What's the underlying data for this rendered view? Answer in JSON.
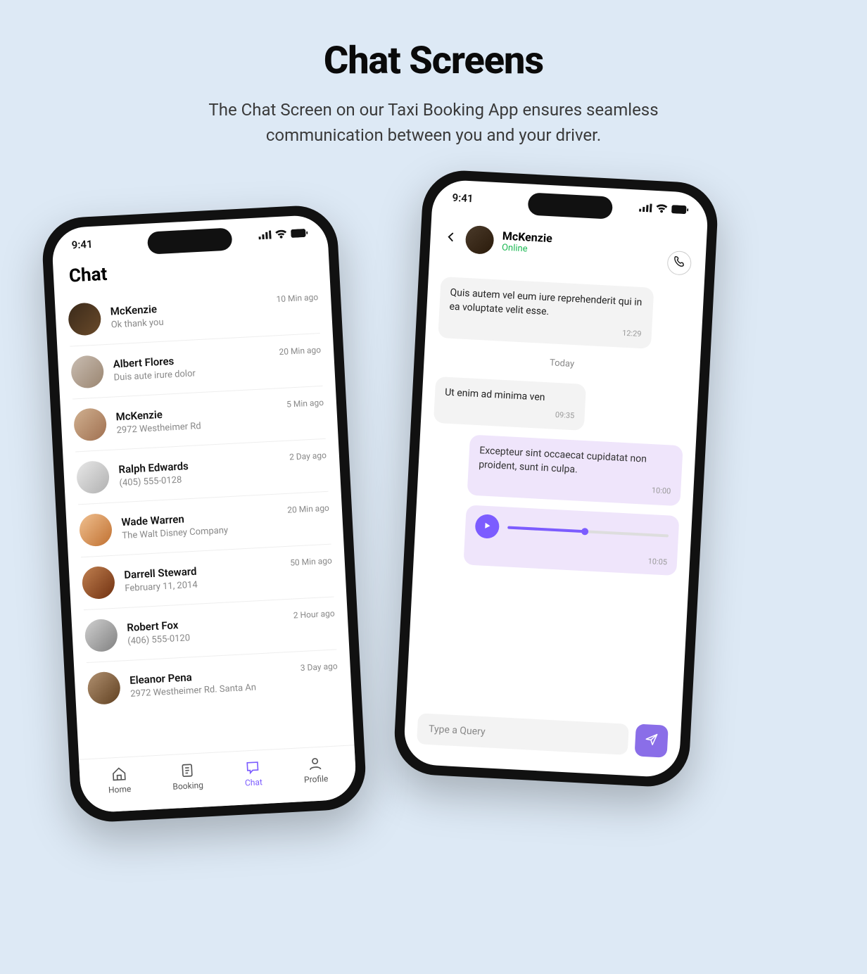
{
  "page": {
    "title": "Chat Screens",
    "subtitle": "The Chat Screen on our Taxi Booking App ensures seamless communication between you and your driver."
  },
  "status_time": "9:41",
  "left": {
    "title": "Chat",
    "chats": [
      {
        "name": "McKenzie",
        "sub": "Ok thank you",
        "time": "10 Min ago"
      },
      {
        "name": "Albert Flores",
        "sub": "Duis aute irure dolor",
        "time": "20 Min ago"
      },
      {
        "name": "McKenzie",
        "sub": "2972 Westheimer Rd",
        "time": "5 Min ago"
      },
      {
        "name": "Ralph Edwards",
        "sub": "(405) 555-0128",
        "time": "2 Day ago"
      },
      {
        "name": "Wade Warren",
        "sub": "The Walt Disney Company",
        "time": "20 Min ago"
      },
      {
        "name": "Darrell Steward",
        "sub": "February 11, 2014",
        "time": "50 Min ago"
      },
      {
        "name": "Robert Fox",
        "sub": "(406) 555-0120",
        "time": "2 Hour ago"
      },
      {
        "name": "Eleanor Pena",
        "sub": "2972 Westheimer Rd. Santa An",
        "time": "3 Day ago"
      }
    ],
    "nav": {
      "home": "Home",
      "booking": "Booking",
      "chat": "Chat",
      "profile": "Profile"
    }
  },
  "right": {
    "name": "McKenzie",
    "status": "Online",
    "messages": {
      "m1": {
        "text": "Quis autem vel eum iure reprehenderit qui in ea voluptate velit esse.",
        "time": "12:29"
      },
      "sep": "Today",
      "m2": {
        "text": "Ut enim ad minima ven",
        "time": "09:35"
      },
      "m3": {
        "text": "Excepteur sint occaecat cupidatat non proident, sunt in culpa.",
        "time": "10:00"
      },
      "m4_time": "10:05"
    },
    "input_placeholder": "Type a Query"
  }
}
